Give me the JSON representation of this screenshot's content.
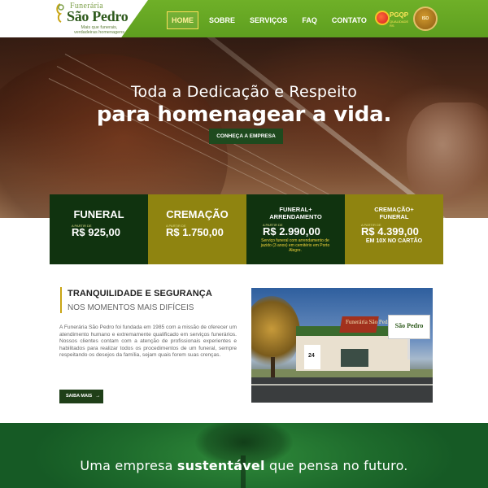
{
  "header": {
    "logo": {
      "small": "Funerária",
      "main": "São Pedro",
      "tagline_1": "Mais que funerais,",
      "tagline_2": "verdadeiras homenagens"
    },
    "nav": [
      {
        "label": "HOME",
        "active": true
      },
      {
        "label": "SOBRE",
        "active": false
      },
      {
        "label": "SERVIÇOS",
        "active": false
      },
      {
        "label": "FAQ",
        "active": false
      },
      {
        "label": "CONTATO",
        "active": false
      }
    ],
    "badge_pgqp": "PGQP",
    "badge_pgqp_sub": "QUALIDADE RS",
    "badge_seal": "ISO",
    "accent_color": "#6fb028"
  },
  "hero": {
    "line1": "Toda a Dedicação e Respeito",
    "line2": "para homenagear a vida.",
    "button": "CONHEÇA A EMPRESA"
  },
  "prices": [
    {
      "title": "FUNERAL",
      "from": "A PARTIR DE",
      "value": "R$ 925,00",
      "note": "",
      "extra": "",
      "style": "dark"
    },
    {
      "title": "CREMAÇÃO",
      "from": "A PARTIR DE",
      "value": "R$ 1.750,00",
      "note": "",
      "extra": "",
      "style": "gold"
    },
    {
      "title": "FUNERAL+ ARRENDAMENTO",
      "from": "A PARTIR DE",
      "value": "R$ 2.990,00",
      "note": "Serviço funeral com arrendamento de jazido (3 anos) em cemitério em Porto Alegre.",
      "extra": "",
      "style": "dark"
    },
    {
      "title": "CREMAÇÃO+ FUNERAL",
      "from": "A PARTIR DE",
      "value": "R$ 4.399,00",
      "note": "",
      "extra": "EM 10X NO CARTÃO",
      "style": "gold"
    }
  ],
  "about": {
    "heading": "TRANQUILIDADE E SEGURANÇA",
    "subheading": "NOS MOMENTOS MAIS DIFÍCEIS",
    "text": "A Funerária São Pedro foi fundada em 1985 com a missão de oferecer um atendimento humano e extremamente qualificado em serviços funerários. Nossos clientes contam com a atenção de profissionais experientes e habilitados para realizar todos os procedimentos de um funeral, sempre respeitando os desejos da família, sejam quais forem suas crenças.",
    "button": "SAIBA MAIS",
    "button_arrow": "→",
    "photo_number": "24",
    "photo_sign": "Funerária São Pedro",
    "photo_billboard": "São Pedro"
  },
  "banner": {
    "text_before": "Uma empresa ",
    "text_bold": "sustentável",
    "text_after": " que pensa no futuro."
  }
}
